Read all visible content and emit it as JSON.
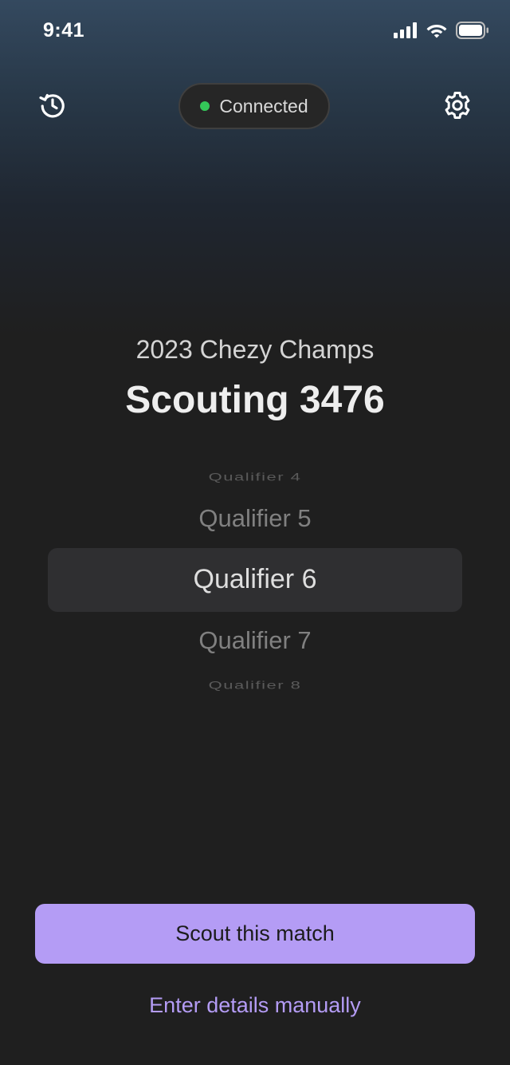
{
  "status_bar": {
    "time": "9:41",
    "icons": [
      "cellular-signal-icon",
      "wifi-icon",
      "battery-icon"
    ]
  },
  "toolbar": {
    "history_icon": "history-icon",
    "settings_icon": "gear-icon",
    "connection": {
      "label": "Connected",
      "dot_color": "#34c759"
    }
  },
  "header": {
    "event_name": "2023 Chezy Champs",
    "title": "Scouting 3476"
  },
  "match_picker": {
    "options": [
      "Qualifier 4",
      "Qualifier 5",
      "Qualifier 6",
      "Qualifier 7",
      "Qualifier 8"
    ],
    "selected": "Qualifier 6"
  },
  "actions": {
    "primary_label": "Scout this match",
    "secondary_label": "Enter details manually",
    "accent_color": "#b49cf5"
  }
}
